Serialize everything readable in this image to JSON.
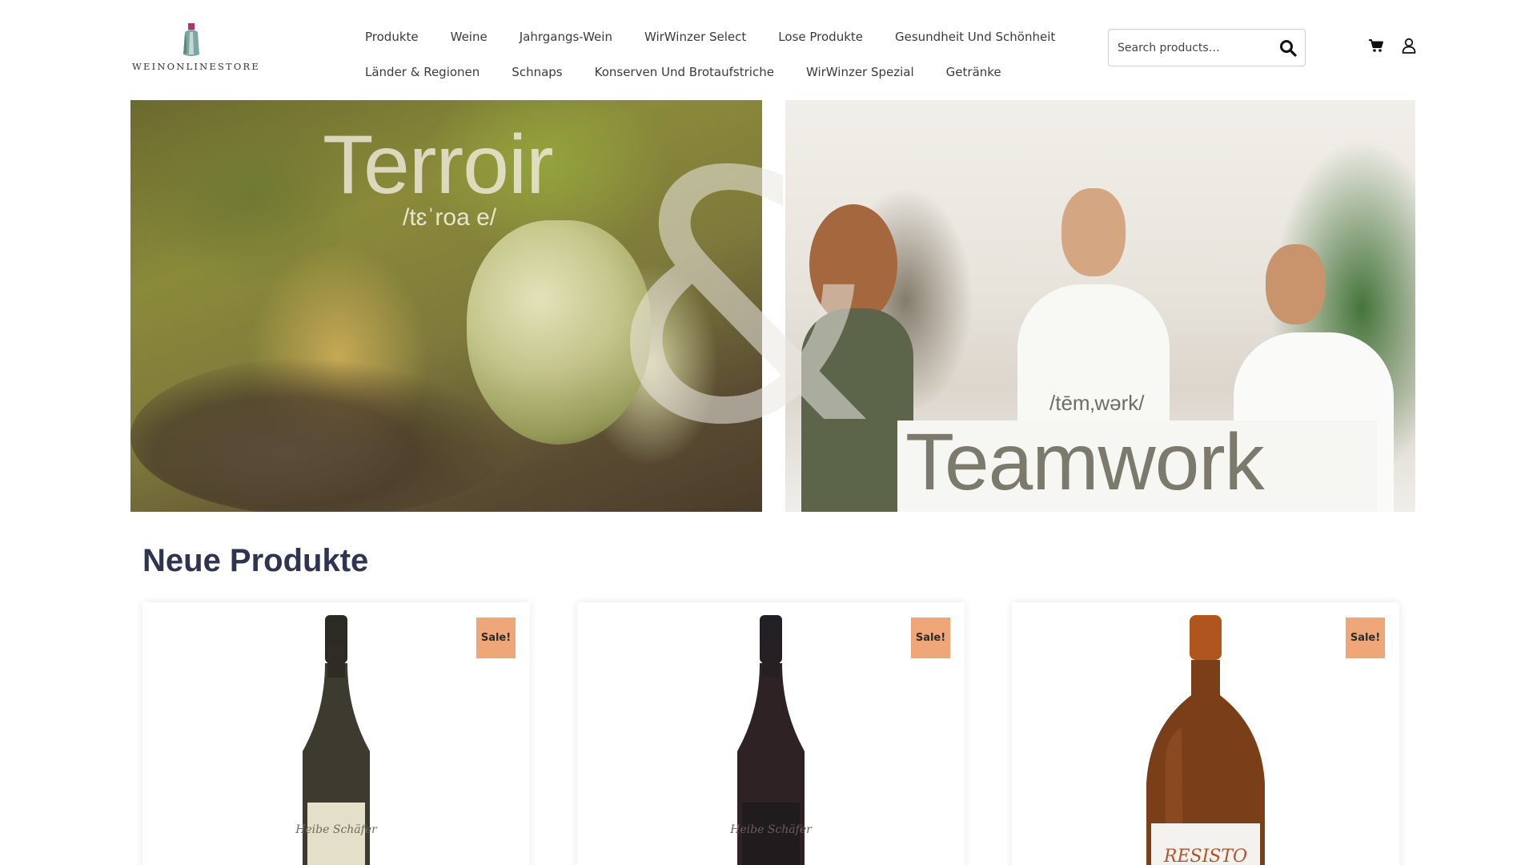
{
  "header": {
    "logo_text": "WEINONLINESTORE",
    "nav_row1": [
      "Produkte",
      "Weine",
      "Jahrgangs-Wein",
      "WirWinzer Select",
      "Lose Produkte",
      "Gesundheit Und Schönheit"
    ],
    "nav_row2": [
      "Länder & Regionen",
      "Schnaps",
      "Konserven Und Brotaufstriche",
      "WirWinzer Spezial",
      "Getränke"
    ],
    "search": {
      "placeholder": "Search products…"
    }
  },
  "banners": {
    "left": {
      "word": "Terroir",
      "phonetic": "/tɛˈroa e/"
    },
    "ampersand": "&",
    "right": {
      "word": "Teamwork",
      "phonetic": "/tēm‚wərk/"
    }
  },
  "products": {
    "title": "Neue Produkte",
    "items": [
      {
        "badge": "Sale!",
        "bottle_color": "#3d3a30",
        "label_color": "#e3dfc8",
        "label_text": "Heibe Schäfer"
      },
      {
        "badge": "Sale!",
        "bottle_color": "#2e2225",
        "label_color": "#201b1d",
        "label_text": "Heibe Schäfer"
      },
      {
        "badge": "Sale!",
        "bottle_color": "#7a3f19",
        "label_color": "#f4f2ee",
        "label_text": "RESISTO"
      }
    ]
  },
  "colors": {
    "title": "#2f3452",
    "sale_badge": "#efa679"
  }
}
